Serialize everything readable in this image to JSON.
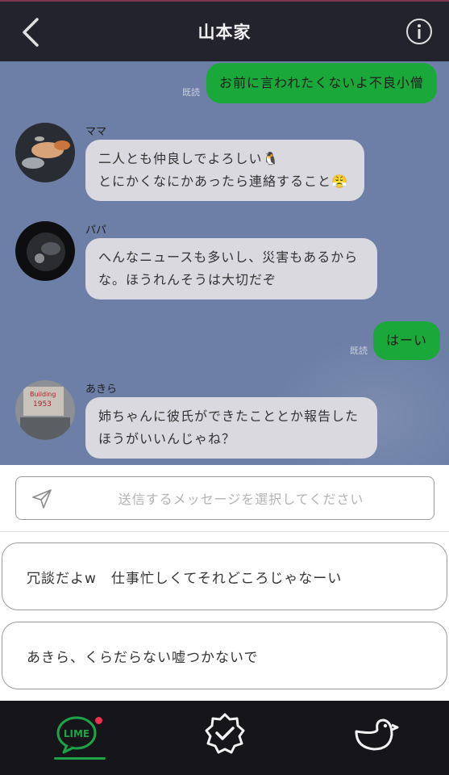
{
  "header": {
    "title": "山本家"
  },
  "messages": [
    {
      "type": "sent",
      "text": "お前に言われたくないよ不良小僧",
      "read": "既読"
    },
    {
      "type": "received",
      "sender": "ママ",
      "text": "二人とも仲良しでよろしい🐧\nとにかくなにかあったら連絡すること😤"
    },
    {
      "type": "received",
      "sender": "パパ",
      "text": "へんなニュースも多いし、災害もあるから\nな。ほうれんそうは大切だぞ"
    },
    {
      "type": "sent",
      "text": "はーい",
      "read": "既読"
    },
    {
      "type": "received",
      "sender": "あきら",
      "text": "姉ちゃんに彼氏ができたこととか報告した\nほうがいいんじゃね？",
      "avatar_text": "Building 1953"
    }
  ],
  "composer": {
    "placeholder": "送信するメッセージを選択してください"
  },
  "options": [
    "冗談だよw　仕事忙しくてそれどころじゃなーい",
    "あきら、くらだらない嘘つかないで"
  ],
  "tabs": [
    {
      "name": "chat",
      "label": "LIME",
      "icon": "speech-bubble-icon",
      "active": true,
      "badge": true
    },
    {
      "name": "verified",
      "icon": "badge-check-icon"
    },
    {
      "name": "bird",
      "icon": "bird-icon"
    }
  ],
  "colors": {
    "header_bg": "#23232d",
    "chat_bg": "#6d7fa6",
    "sent_bubble": "#1aa83a",
    "received_bubble": "#d9d9df",
    "tabbar_bg": "#15151a",
    "accent_green": "#1ea447",
    "badge_red": "#e8324f"
  }
}
